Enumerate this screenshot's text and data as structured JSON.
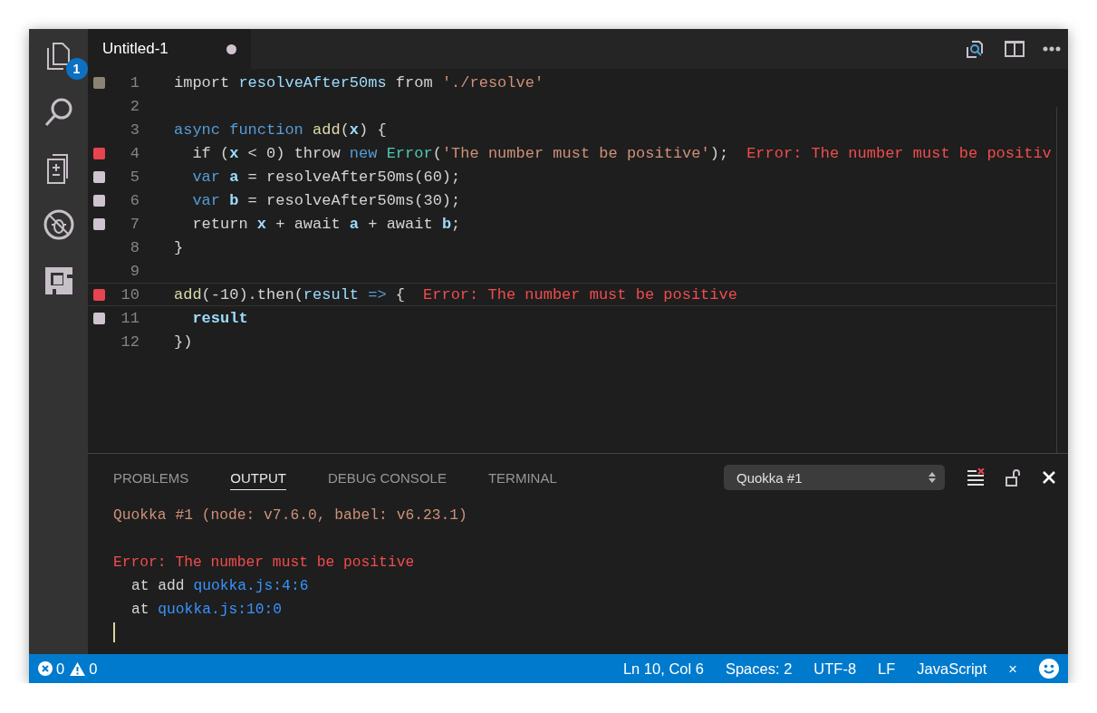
{
  "activity_bar": {
    "badge": "1"
  },
  "tab": {
    "title": "Untitled-1",
    "dirty": true
  },
  "code_lines": [
    {
      "number": "1",
      "color": "#8c8377",
      "current": false,
      "tokens": [
        {
          "kind": "plain",
          "text": "import "
        },
        {
          "kind": "import",
          "text": "resolveAfter50ms"
        },
        {
          "kind": "plain",
          "text": " from "
        },
        {
          "kind": "string",
          "text": "'./resolve'"
        }
      ]
    },
    {
      "number": "2",
      "current": false
    },
    {
      "number": "3",
      "current": false,
      "tokens": [
        {
          "kind": "keyword",
          "text": "async function "
        },
        {
          "kind": "fn",
          "text": "add"
        },
        {
          "kind": "plain",
          "text": "("
        },
        {
          "kind": "var",
          "text": "x"
        },
        {
          "kind": "plain",
          "text": ") {"
        }
      ]
    },
    {
      "number": "4",
      "color": "#e8434f",
      "current": false,
      "tokens": [
        {
          "kind": "plain",
          "text": "  if ("
        },
        {
          "kind": "var",
          "text": "x"
        },
        {
          "kind": "plain",
          "text": " < 0) throw "
        },
        {
          "kind": "keyword",
          "text": "new "
        },
        {
          "kind": "class",
          "text": "Error"
        },
        {
          "kind": "plain",
          "text": "("
        },
        {
          "kind": "string",
          "text": "'The number must be positive'"
        },
        {
          "kind": "plain",
          "text": ");"
        }
      ],
      "error": "Error: The number must be positiv"
    },
    {
      "number": "5",
      "color": "#cfc3cf",
      "current": false,
      "tokens": [
        {
          "kind": "keyword",
          "text": "  var "
        },
        {
          "kind": "var",
          "text": "a"
        },
        {
          "kind": "plain",
          "text": " = resolveAfter50ms(60);"
        }
      ]
    },
    {
      "number": "6",
      "color": "#cfc3cf",
      "current": false,
      "tokens": [
        {
          "kind": "keyword",
          "text": "  var "
        },
        {
          "kind": "var",
          "text": "b"
        },
        {
          "kind": "plain",
          "text": " = resolveAfter50ms(30);"
        }
      ]
    },
    {
      "number": "7",
      "color": "#cfc3cf",
      "current": false,
      "tokens": [
        {
          "kind": "plain",
          "text": "  return "
        },
        {
          "kind": "var",
          "text": "x"
        },
        {
          "kind": "plain",
          "text": " + await "
        },
        {
          "kind": "var",
          "text": "a"
        },
        {
          "kind": "plain",
          "text": " + await "
        },
        {
          "kind": "var",
          "text": "b"
        },
        {
          "kind": "plain",
          "text": ";"
        }
      ]
    },
    {
      "number": "8",
      "current": false,
      "tokens": [
        {
          "kind": "plain",
          "text": "}"
        }
      ]
    },
    {
      "number": "9",
      "current": false
    },
    {
      "number": "10",
      "color": "#e8434f",
      "current": true,
      "tokens": [
        {
          "kind": "fn",
          "text": "add"
        },
        {
          "kind": "plain",
          "text": "(-10).then("
        },
        {
          "kind": "param",
          "text": "result"
        },
        {
          "kind": "keyword",
          "text": " => "
        },
        {
          "kind": "plain",
          "text": "{"
        }
      ],
      "error": "Error: The number must be positive"
    },
    {
      "number": "11",
      "color": "#cfc3cf",
      "current": false,
      "tokens": [
        {
          "kind": "var",
          "text": "  result"
        }
      ]
    },
    {
      "number": "12",
      "current": false,
      "tokens": [
        {
          "kind": "plain",
          "text": "})"
        }
      ]
    }
  ],
  "panel": {
    "tabs": [
      {
        "label": "PROBLEMS",
        "selected": false
      },
      {
        "label": "OUTPUT",
        "selected": true
      },
      {
        "label": "DEBUG CONSOLE",
        "selected": false
      },
      {
        "label": "TERMINAL",
        "selected": false
      }
    ],
    "channel": "Quokka #1",
    "output": [
      {
        "kind": "header",
        "parts": [
          {
            "kind": "text",
            "text": "Quokka #1 (node: v7.6.0, babel: v6.23.1)"
          }
        ]
      },
      {
        "kind": "error",
        "parts": [
          {
            "kind": "text",
            "text": "Error: The number must be positive"
          }
        ]
      },
      {
        "kind": "trace",
        "parts": [
          {
            "kind": "text",
            "text": "at add "
          },
          {
            "kind": "link",
            "text": "quokka.js:4:6"
          }
        ]
      },
      {
        "kind": "trace",
        "parts": [
          {
            "kind": "text",
            "text": "at "
          },
          {
            "kind": "link",
            "text": "quokka.js:10:0"
          }
        ]
      }
    ]
  },
  "status_bar": {
    "errors": "0",
    "warnings": "0",
    "items": [
      "Ln 10, Col 6",
      "Spaces: 2",
      "UTF-8",
      "LF",
      "JavaScript",
      "×"
    ]
  }
}
